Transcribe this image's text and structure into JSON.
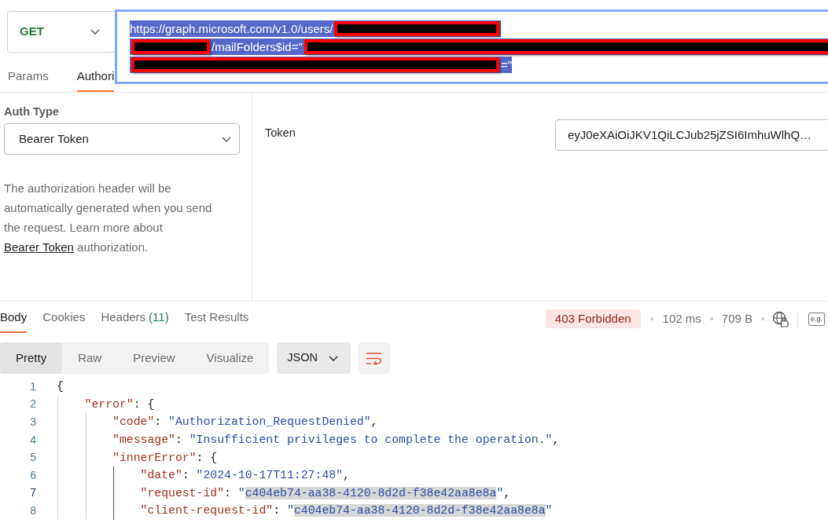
{
  "request": {
    "method": "GET",
    "url": {
      "focused": true,
      "selected": true,
      "lines": [
        [
          {
            "kind": "text",
            "text": "https://graph.microsoft.com/v1.0/users/"
          },
          {
            "kind": "redaction"
          }
        ],
        [
          {
            "kind": "redaction"
          },
          {
            "kind": "text",
            "text": "/mailFolders$id=\""
          },
          {
            "kind": "redaction"
          }
        ],
        [
          {
            "kind": "redaction"
          },
          {
            "kind": "text",
            "text": "=\""
          }
        ]
      ]
    },
    "tabs": [
      {
        "label": "Params",
        "selected": false
      },
      {
        "label": "Authori",
        "selected": true
      }
    ]
  },
  "auth": {
    "type_label": "Auth Type",
    "type_value": "Bearer Token",
    "description": {
      "text": "The authorization header will be automatically generated when you send the request. Learn more about",
      "link": "Bearer Token",
      "after": "authorization."
    },
    "token_label": "Token",
    "token_value": "eyJ0eXAiOiJKV1QiLCJub25jZSI6ImhuWlhQ…"
  },
  "response": {
    "tabs": [
      {
        "label": "Body",
        "selected": true
      },
      {
        "label": "Cookies",
        "selected": false
      },
      {
        "label": "Headers",
        "count": "(11)",
        "selected": false
      },
      {
        "label": "Test Results",
        "selected": false
      }
    ],
    "status": "403 Forbidden",
    "time": "102 ms",
    "size": "709 B",
    "examples_button": "e.g.",
    "view_tabs": [
      {
        "label": "Pretty",
        "selected": true
      },
      {
        "label": "Raw",
        "selected": false
      },
      {
        "label": "Preview",
        "selected": false
      },
      {
        "label": "Visualize",
        "selected": false
      }
    ],
    "format": "JSON",
    "code": [
      {
        "number": "1",
        "current": false,
        "tokens": [
          {
            "kind": "punct",
            "text": "{"
          }
        ],
        "children": [
          {
            "number": "2",
            "current": false,
            "tokens": [
              {
                "kind": "key",
                "text": "\"error\""
              },
              {
                "kind": "punct",
                "text": ": {"
              }
            ],
            "children": [
              {
                "number": "3",
                "current": false,
                "tokens": [
                  {
                    "kind": "key",
                    "text": "\"code\""
                  },
                  {
                    "kind": "punct",
                    "text": ": "
                  },
                  {
                    "kind": "string",
                    "text": "\"Authorization_RequestDenied\""
                  },
                  {
                    "kind": "punct",
                    "text": ","
                  }
                ]
              },
              {
                "number": "4",
                "current": false,
                "tokens": [
                  {
                    "kind": "key",
                    "text": "\"message\""
                  },
                  {
                    "kind": "punct",
                    "text": ": "
                  },
                  {
                    "kind": "string",
                    "text": "\"Insufficient privileges to complete the operation.\""
                  },
                  {
                    "kind": "punct",
                    "text": ","
                  }
                ]
              },
              {
                "number": "5",
                "current": false,
                "tokens": [
                  {
                    "kind": "key",
                    "text": "\"innerError\""
                  },
                  {
                    "kind": "punct",
                    "text": ": {"
                  }
                ],
                "children": [
                  {
                    "number": "6",
                    "current": false,
                    "tokens": [
                      {
                        "kind": "key",
                        "text": "\"date\""
                      },
                      {
                        "kind": "punct",
                        "text": ": "
                      },
                      {
                        "kind": "string",
                        "text": "\"2024-10-17T11:27:48\""
                      },
                      {
                        "kind": "punct",
                        "text": ","
                      }
                    ]
                  },
                  {
                    "number": "7",
                    "current": true,
                    "tokens": [
                      {
                        "kind": "key",
                        "text": "\"request-id\""
                      },
                      {
                        "kind": "punct",
                        "text": ": "
                      },
                      {
                        "kind": "string",
                        "text": "\""
                      },
                      {
                        "kind": "selection",
                        "text": "c404eb74-aa38-4120-8d2d-f38e42aa8e8a"
                      },
                      {
                        "kind": "string",
                        "text": "\""
                      },
                      {
                        "kind": "punct",
                        "text": ","
                      }
                    ]
                  },
                  {
                    "number": "8",
                    "current": false,
                    "tokens": [
                      {
                        "kind": "key",
                        "text": "\"client-request-id\""
                      },
                      {
                        "kind": "punct",
                        "text": ": "
                      },
                      {
                        "kind": "string",
                        "text": "\""
                      },
                      {
                        "kind": "selection",
                        "text": "c404eb74-aa38-4120-8d2d-f38e42aa8e8a"
                      },
                      {
                        "kind": "string",
                        "text": "\""
                      }
                    ]
                  }
                ]
              }
            ]
          }
        ]
      }
    ]
  }
}
